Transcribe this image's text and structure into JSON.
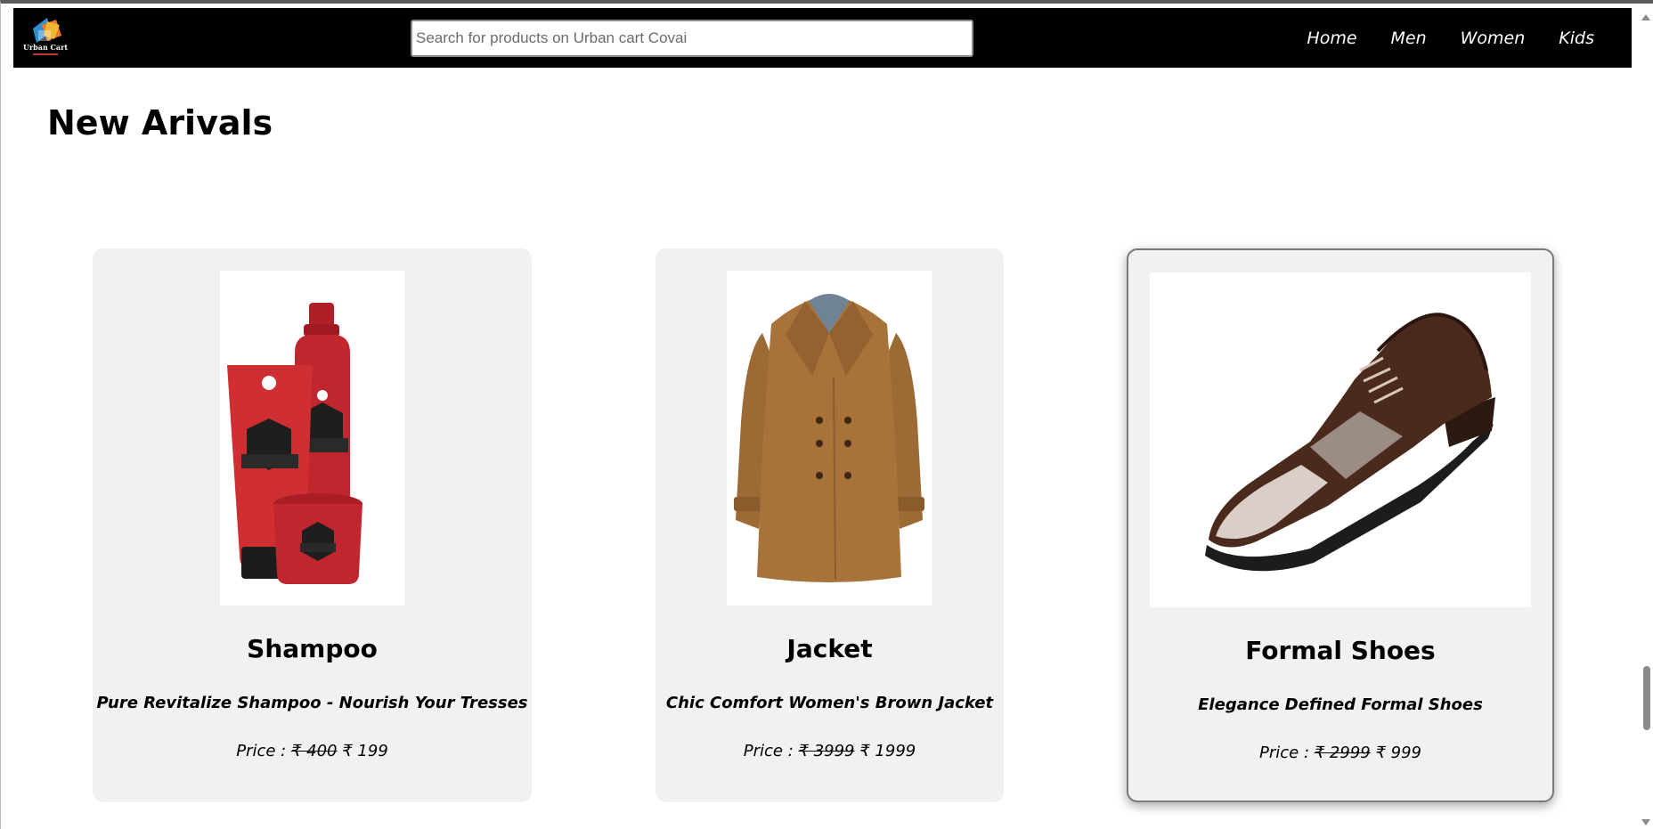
{
  "header": {
    "logo_text": "Urban Cart",
    "search_placeholder": "Search for products on Urban cart Covai",
    "nav": [
      "Home",
      "Men",
      "Women",
      "Kids"
    ]
  },
  "section": {
    "title": "New Arivals"
  },
  "products": [
    {
      "name": "Shampoo",
      "description": "Pure Revitalize Shampoo - Nourish Your Tresses",
      "price_prefix": "Price : ",
      "old_price": "₹ 400",
      "new_price": "₹ 199",
      "image_icon": "shampoo-bottles-icon"
    },
    {
      "name": "Jacket",
      "description": "Chic Comfort Women's Brown Jacket",
      "price_prefix": "Price : ",
      "old_price": "₹ 3999",
      "new_price": "₹ 1999",
      "image_icon": "brown-coat-icon"
    },
    {
      "name": "Formal Shoes",
      "description": "Elegance Defined Formal Shoes",
      "price_prefix": "Price : ",
      "old_price": "₹ 2999",
      "new_price": "₹ 999",
      "image_icon": "formal-shoe-icon"
    }
  ],
  "colors": {
    "navbar_bg": "#000000",
    "card_bg": "#f2f0f1",
    "shampoo_red": "#c0262d",
    "coat_brown": "#a8733a",
    "shoe_brown": "#4a2a1c"
  }
}
